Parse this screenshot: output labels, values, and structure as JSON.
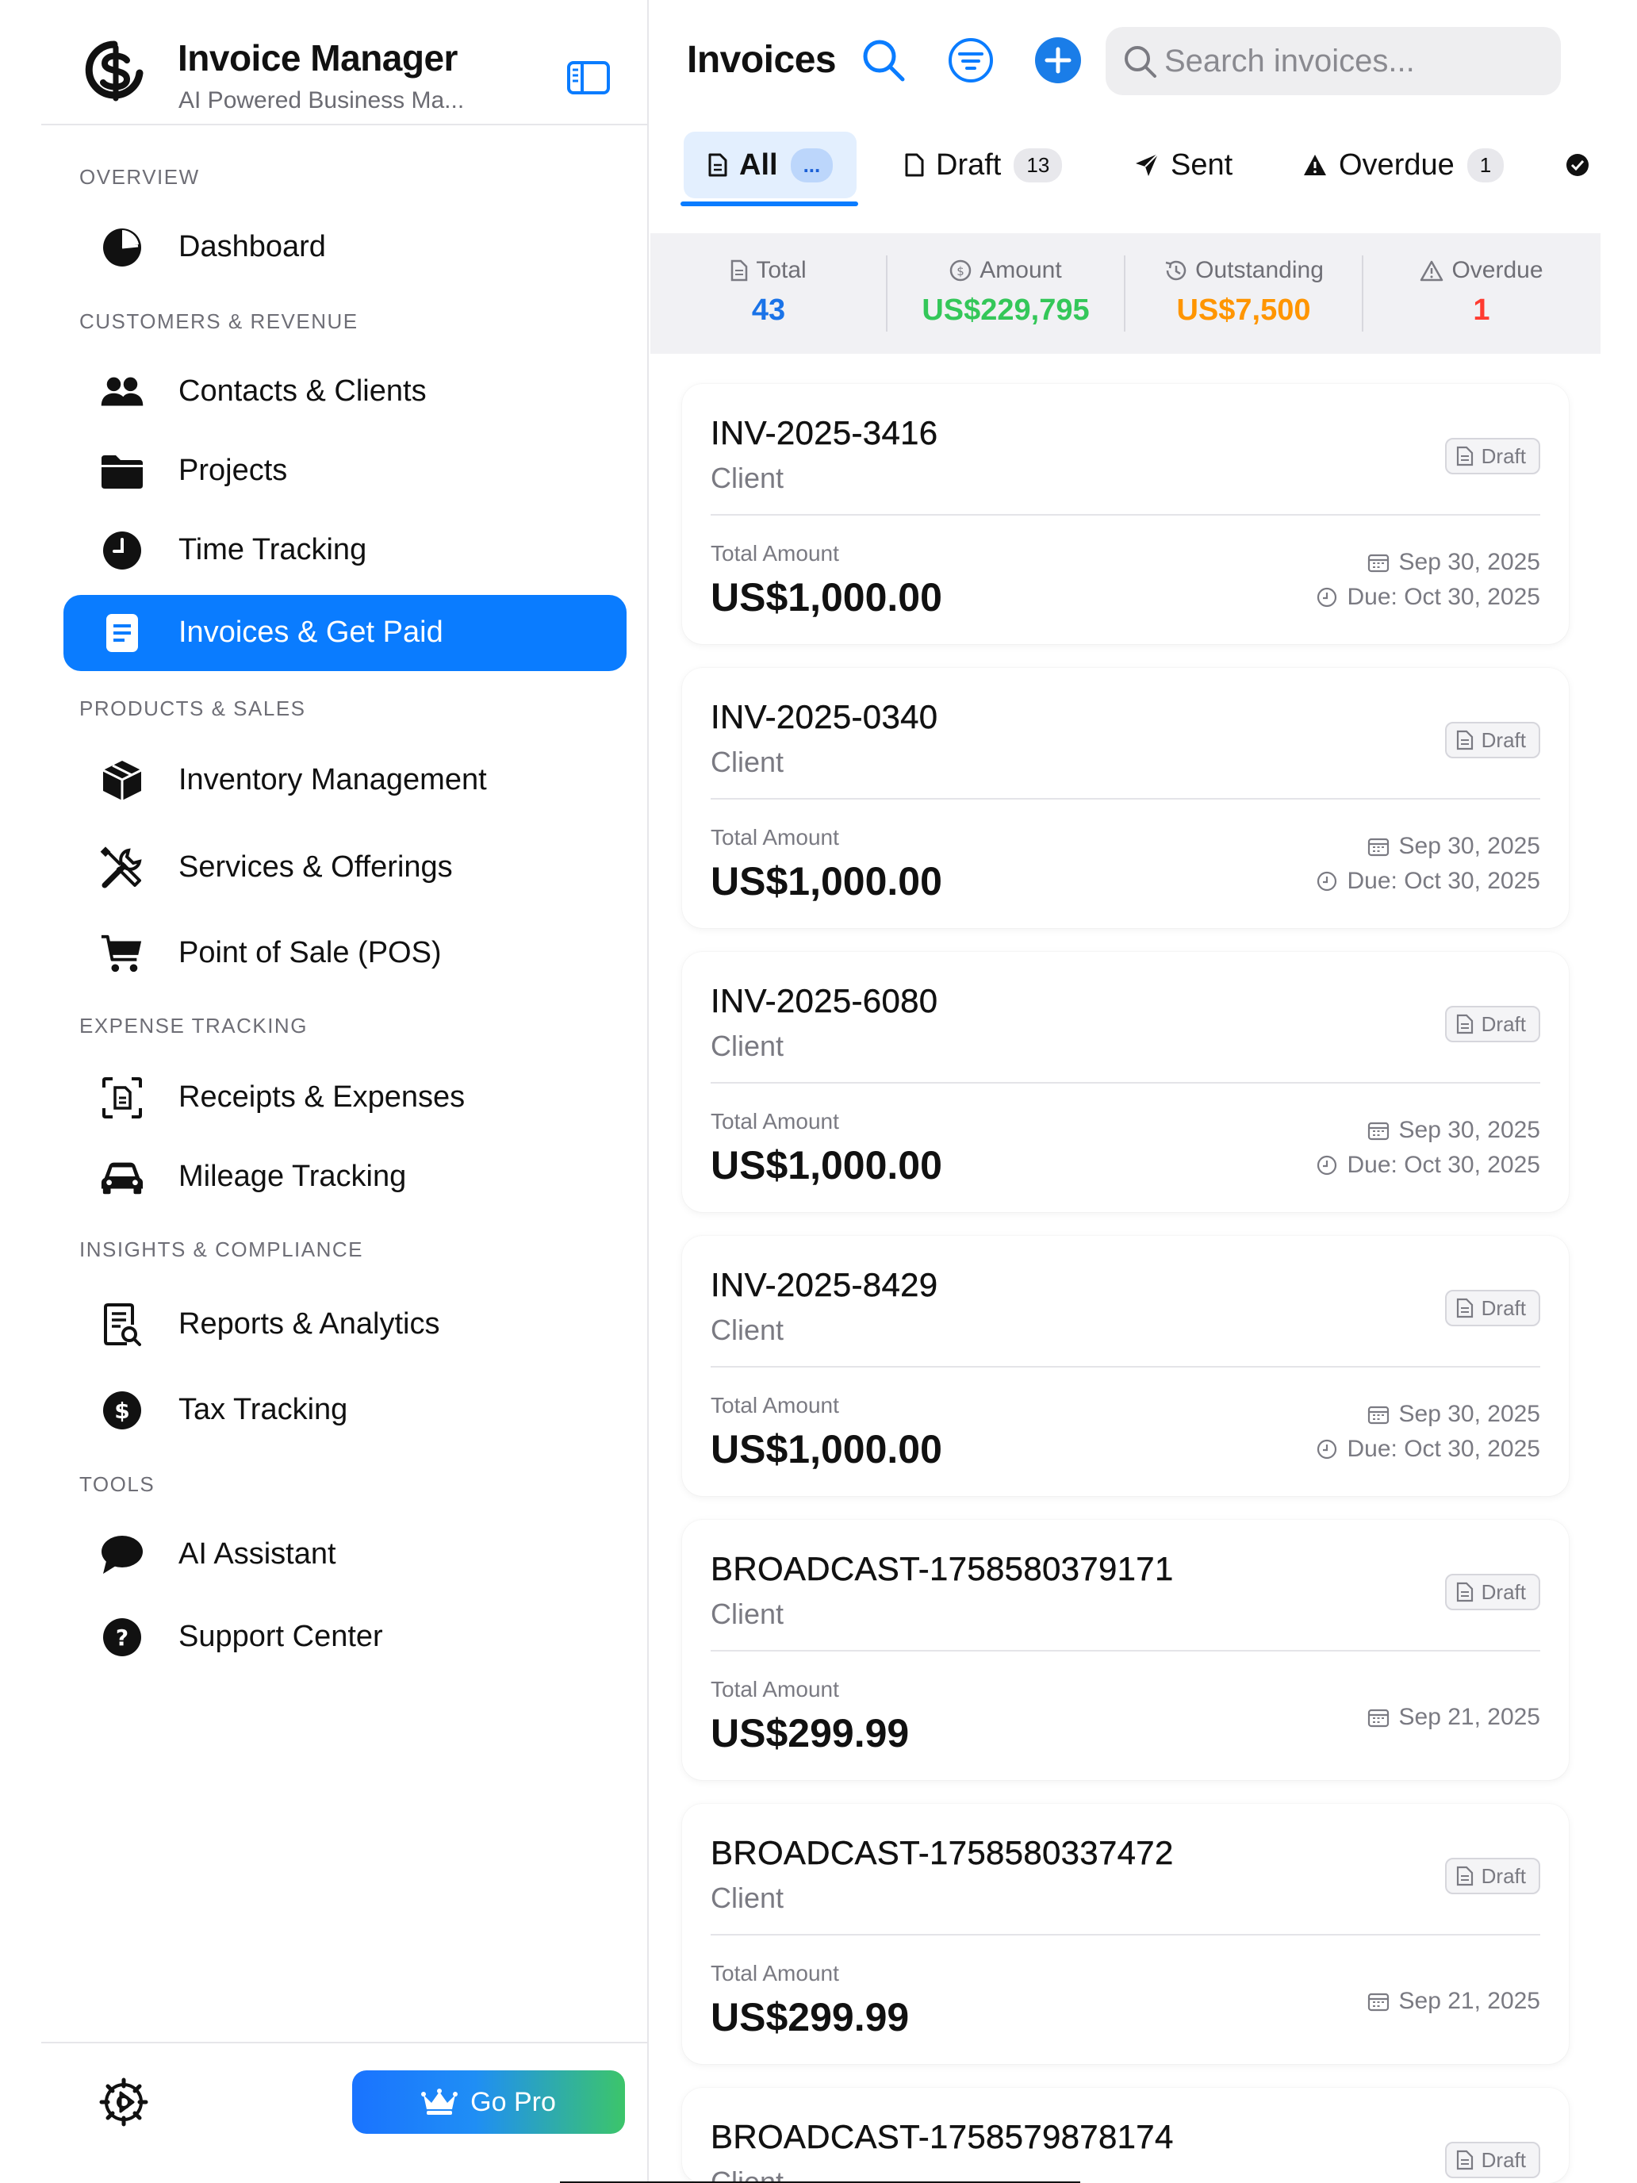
{
  "app": {
    "title": "Invoice Manager",
    "subtitle": "AI Powered Business Ma...",
    "accent_color": "#0a7cff"
  },
  "sidebar": {
    "sections": [
      {
        "label": "OVERVIEW"
      },
      {
        "label": "CUSTOMERS & REVENUE"
      },
      {
        "label": "PRODUCTS & SALES"
      },
      {
        "label": "EXPENSE TRACKING"
      },
      {
        "label": "INSIGHTS & COMPLIANCE"
      },
      {
        "label": "TOOLS"
      }
    ],
    "items": [
      {
        "label": "Dashboard",
        "icon": "pie-chart-icon"
      },
      {
        "label": "Contacts & Clients",
        "icon": "people-icon"
      },
      {
        "label": "Projects",
        "icon": "folder-icon"
      },
      {
        "label": "Time Tracking",
        "icon": "clock-icon"
      },
      {
        "label": "Invoices & Get Paid",
        "icon": "document-icon",
        "active": true
      },
      {
        "label": "Inventory Management",
        "icon": "cube-icon"
      },
      {
        "label": "Services & Offerings",
        "icon": "tools-icon"
      },
      {
        "label": "Point of Sale (POS)",
        "icon": "cart-icon"
      },
      {
        "label": "Receipts & Expenses",
        "icon": "receipt-scan-icon"
      },
      {
        "label": "Mileage Tracking",
        "icon": "car-icon"
      },
      {
        "label": "Reports & Analytics",
        "icon": "report-search-icon"
      },
      {
        "label": "Tax Tracking",
        "icon": "dollar-circle-icon"
      },
      {
        "label": "AI Assistant",
        "icon": "chat-bubble-icon"
      },
      {
        "label": "Support Center",
        "icon": "help-circle-icon"
      }
    ],
    "footer": {
      "go_pro_label": "Go Pro"
    }
  },
  "main": {
    "title": "Invoices",
    "search": {
      "placeholder": "Search invoices...",
      "value": ""
    },
    "tabs": [
      {
        "label": "All",
        "badge": "...",
        "active": true
      },
      {
        "label": "Draft",
        "badge": "13"
      },
      {
        "label": "Sent",
        "badge": ""
      },
      {
        "label": "Overdue",
        "badge": "1"
      }
    ],
    "stats": [
      {
        "label": "Total",
        "value": "43",
        "color": "#1a73e8"
      },
      {
        "label": "Amount",
        "value": "US$229,795",
        "color": "#34c759"
      },
      {
        "label": "Outstanding",
        "value": "US$7,500",
        "color": "#ff9500"
      },
      {
        "label": "Overdue",
        "value": "1",
        "color": "#ff3b30"
      }
    ],
    "amount_label": "Total Amount",
    "invoices": [
      {
        "number": "INV-2025-3416",
        "client": "Client",
        "status": "Draft",
        "amount": "US$1,000.00",
        "date": "Sep 30, 2025",
        "due": "Due: Oct 30, 2025"
      },
      {
        "number": "INV-2025-0340",
        "client": "Client",
        "status": "Draft",
        "amount": "US$1,000.00",
        "date": "Sep 30, 2025",
        "due": "Due: Oct 30, 2025"
      },
      {
        "number": "INV-2025-6080",
        "client": "Client",
        "status": "Draft",
        "amount": "US$1,000.00",
        "date": "Sep 30, 2025",
        "due": "Due: Oct 30, 2025"
      },
      {
        "number": "INV-2025-8429",
        "client": "Client",
        "status": "Draft",
        "amount": "US$1,000.00",
        "date": "Sep 30, 2025",
        "due": "Due: Oct 30, 2025"
      },
      {
        "number": "BROADCAST-1758580379171",
        "client": "Client",
        "status": "Draft",
        "amount": "US$299.99",
        "date": "Sep 21, 2025",
        "due": ""
      },
      {
        "number": "BROADCAST-1758580337472",
        "client": "Client",
        "status": "Draft",
        "amount": "US$299.99",
        "date": "Sep 21, 2025",
        "due": ""
      },
      {
        "number": "BROADCAST-1758579878174",
        "client": "Client",
        "status": "Draft",
        "amount": "",
        "date": "",
        "due": ""
      }
    ]
  }
}
